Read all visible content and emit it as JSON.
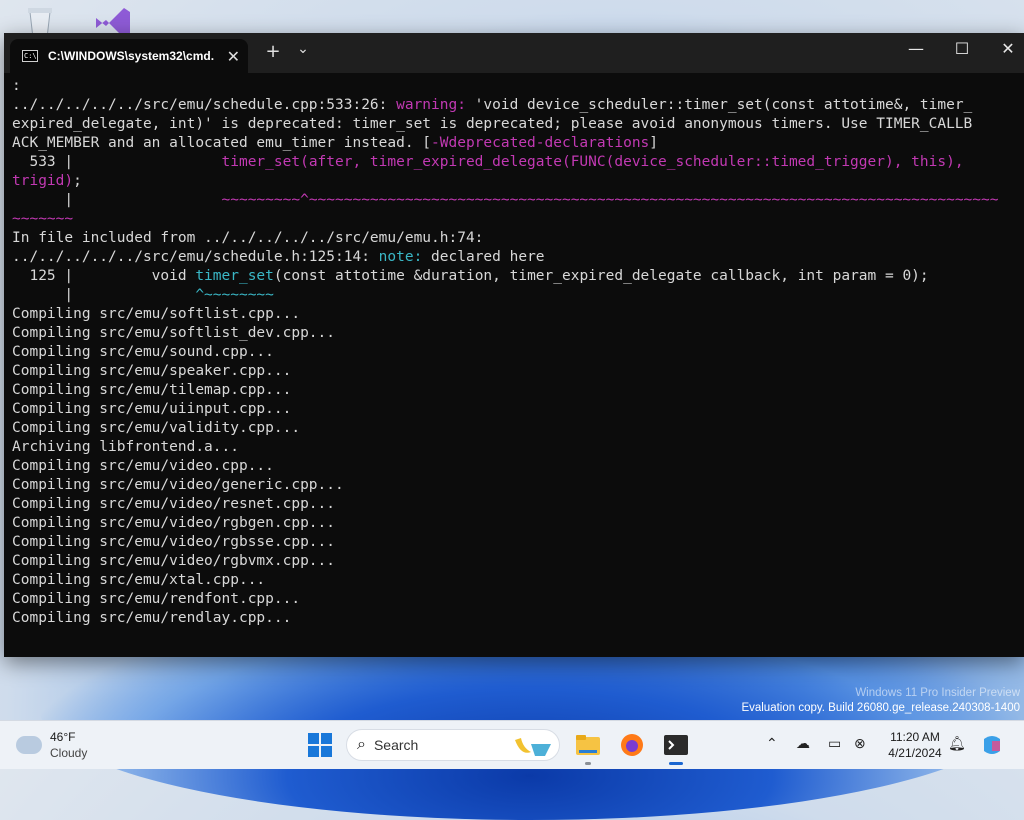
{
  "terminal": {
    "tab_title": "C:\\WINDOWS\\system32\\cmd.",
    "new_tab_glyph": "+",
    "dropdown_glyph": "⌄",
    "close_tab_glyph": "✕",
    "minimize_glyph": "—",
    "maximize_glyph": "☐",
    "close_glyph": "✕",
    "colors": {
      "background": "#0c0c0c",
      "magenta": "#c239b3",
      "cyan": "#3ab7c6",
      "text": "#d8d8d8"
    },
    "lines": [
      [
        {
          "t": ":"
        }
      ],
      [
        {
          "t": "../../../../../src/emu/schedule.cpp:533:26: "
        },
        {
          "t": "warning:",
          "c": "mag"
        },
        {
          "t": " 'void device_scheduler::timer_set(const attotime&, timer_"
        }
      ],
      [
        {
          "t": "expired_delegate, int)' is deprecated: timer_set is deprecated; please avoid anonymous timers. Use TIMER_CALLB"
        }
      ],
      [
        {
          "t": "ACK_MEMBER and an allocated emu_timer instead. ["
        },
        {
          "t": "-Wdeprecated-declarations",
          "c": "mag"
        },
        {
          "t": "]"
        }
      ],
      [
        {
          "t": "  533 |                 "
        },
        {
          "t": "timer_set(after, timer_expired_delegate(FUNC(device_scheduler::timed_trigger), this),",
          "c": "mag"
        }
      ],
      [
        {
          "t": "trigid)",
          "c": "mag"
        },
        {
          "t": ";"
        }
      ],
      [
        {
          "t": "      |                 "
        },
        {
          "t": "~~~~~~~~~^~~~~~~~~~~~~~~~~~~~~~~~~~~~~~~~~~~~~~~~~~~~~~~~~~~~~~~~~~~~~~~~~~~~~~~~~~~~~~~~",
          "c": "mag"
        }
      ],
      [
        {
          "t": "~~~~~~~",
          "c": "mag"
        }
      ],
      [
        {
          "t": "In file included from ../../../../../src/emu/emu.h:74:"
        }
      ],
      [
        {
          "t": "../../../../../src/emu/schedule.h:125:14: "
        },
        {
          "t": "note:",
          "c": "cyan"
        },
        {
          "t": " declared here"
        }
      ],
      [
        {
          "t": "  125 |         void "
        },
        {
          "t": "timer_set",
          "c": "cyan"
        },
        {
          "t": "(const attotime &duration, timer_expired_delegate callback, int param = 0);"
        }
      ],
      [
        {
          "t": "      |              "
        },
        {
          "t": "^~~~~~~~~",
          "c": "cyan"
        }
      ],
      [
        {
          "t": "Compiling src/emu/softlist.cpp..."
        }
      ],
      [
        {
          "t": "Compiling src/emu/softlist_dev.cpp..."
        }
      ],
      [
        {
          "t": "Compiling src/emu/sound.cpp..."
        }
      ],
      [
        {
          "t": "Compiling src/emu/speaker.cpp..."
        }
      ],
      [
        {
          "t": "Compiling src/emu/tilemap.cpp..."
        }
      ],
      [
        {
          "t": "Compiling src/emu/uiinput.cpp..."
        }
      ],
      [
        {
          "t": "Compiling src/emu/validity.cpp..."
        }
      ],
      [
        {
          "t": "Archiving libfrontend.a..."
        }
      ],
      [
        {
          "t": "Compiling src/emu/video.cpp..."
        }
      ],
      [
        {
          "t": "Compiling src/emu/video/generic.cpp..."
        }
      ],
      [
        {
          "t": "Compiling src/emu/video/resnet.cpp..."
        }
      ],
      [
        {
          "t": "Compiling src/emu/video/rgbgen.cpp..."
        }
      ],
      [
        {
          "t": "Compiling src/emu/video/rgbsse.cpp..."
        }
      ],
      [
        {
          "t": "Compiling src/emu/video/rgbvmx.cpp..."
        }
      ],
      [
        {
          "t": "Compiling src/emu/xtal.cpp..."
        }
      ],
      [
        {
          "t": "Compiling src/emu/rendfont.cpp..."
        }
      ],
      [
        {
          "t": "Compiling src/emu/rendlay.cpp..."
        }
      ]
    ]
  },
  "watermark": {
    "line1": "Windows 11 Pro Insider Preview",
    "line2": "Evaluation copy. Build 26080.ge_release.240308-1400"
  },
  "taskbar": {
    "weather": {
      "temp": "46°F",
      "condition": "Cloudy",
      "icon": "cloud-icon"
    },
    "search_label": "Search",
    "apps": [
      "start-icon",
      "file-explorer-icon",
      "firefox-icon",
      "terminal-icon"
    ],
    "tray_icons": [
      "chevron-up-icon",
      "onedrive-offline-icon",
      "display-icon",
      "network-icon",
      "notification-bell-icon",
      "copilot-icon"
    ],
    "time": "11:20 AM",
    "date": "4/21/2024",
    "accent": "#1a66d1"
  }
}
